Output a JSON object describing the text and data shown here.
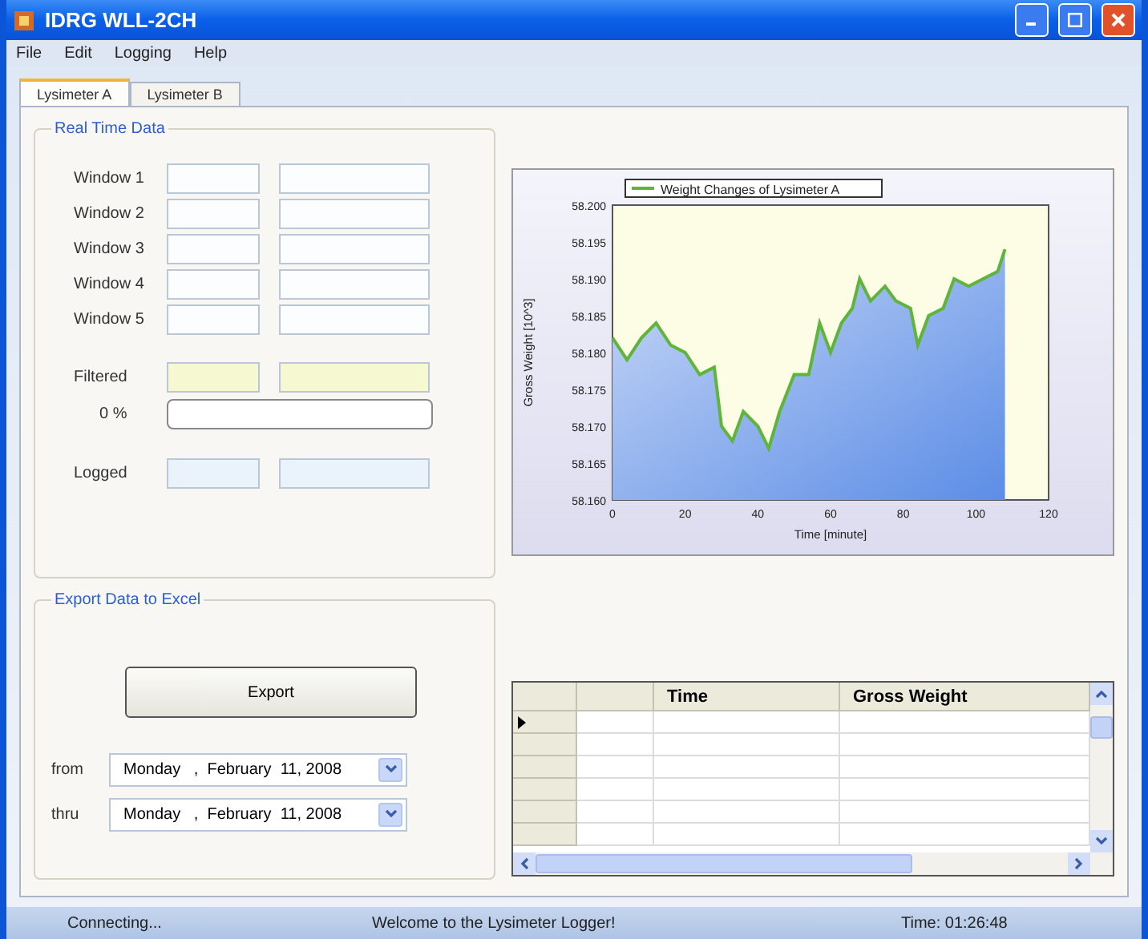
{
  "window": {
    "title": "IDRG WLL-2CH"
  },
  "menu": [
    "File",
    "Edit",
    "Logging",
    "Help"
  ],
  "tabs": [
    {
      "label": "Lysimeter A",
      "selected": true
    },
    {
      "label": "Lysimeter B",
      "selected": false
    }
  ],
  "real_time_data": {
    "title": "Real Time Data",
    "windows": [
      {
        "label": "Window 1"
      },
      {
        "label": "Window 2"
      },
      {
        "label": "Window 3"
      },
      {
        "label": "Window 4"
      },
      {
        "label": "Window 5"
      }
    ],
    "filtered": {
      "label": "Filtered"
    },
    "progress": {
      "label": "0 %",
      "level": 0
    },
    "logged": {
      "label": "Logged"
    }
  },
  "chart": {
    "chart_data": {
      "type": "area",
      "xlabel": "Time [minute]",
      "ylabel": "Gross Weight [10^3]",
      "x": [
        0,
        4,
        8,
        12,
        16,
        20,
        24,
        28,
        30,
        33,
        36,
        40,
        43,
        46,
        50,
        54,
        57,
        60,
        63,
        66,
        68,
        71,
        75,
        78,
        82,
        84,
        87,
        91,
        94,
        98,
        102,
        106,
        108
      ],
      "series": [
        {
          "name": "Weight Changes of Lysimeter A",
          "color": "#5fb43c",
          "values": [
            58.182,
            58.179,
            58.182,
            58.184,
            58.181,
            58.18,
            58.177,
            58.178,
            58.17,
            58.168,
            58.172,
            58.17,
            58.167,
            58.172,
            58.177,
            58.177,
            58.184,
            58.18,
            58.184,
            58.186,
            58.19,
            58.187,
            58.189,
            58.187,
            58.186,
            58.181,
            58.185,
            58.186,
            58.19,
            58.189,
            58.19,
            58.191,
            58.194
          ]
        }
      ],
      "xlim": [
        0,
        120
      ],
      "ylim": [
        58.16,
        58.2
      ],
      "xticks": [
        0,
        20,
        40,
        60,
        80,
        100,
        120
      ],
      "yticks": [
        {
          "value": 58.16,
          "label": "58.160"
        },
        {
          "value": 58.165,
          "label": "58.165"
        },
        {
          "value": 58.17,
          "label": "58.170"
        },
        {
          "value": 58.175,
          "label": "58.175"
        },
        {
          "value": 58.18,
          "label": "58.180"
        },
        {
          "value": 58.185,
          "label": "58.185"
        },
        {
          "value": 58.19,
          "label": "58.190"
        },
        {
          "value": 58.195,
          "label": "58.195"
        },
        {
          "value": 58.2,
          "label": "58.200"
        }
      ]
    }
  },
  "export": {
    "title": "Export Data to Excel",
    "button": "Export",
    "dates": [
      {
        "label": "from",
        "value": "Monday   ,  February  11, 2008"
      },
      {
        "label": "thru",
        "value": "Monday   ,  February  11, 2008"
      }
    ]
  },
  "table": {
    "columns": [
      "Time",
      "Gross Weight"
    ],
    "rows": [
      {
        "current": true
      },
      {
        "current": false
      },
      {
        "current": false
      },
      {
        "current": false
      },
      {
        "current": false
      },
      {
        "current": false
      }
    ]
  },
  "status_bar": [
    "Connecting...",
    "Welcome to the Lysimeter Logger!",
    "Time: 01:26:48"
  ]
}
